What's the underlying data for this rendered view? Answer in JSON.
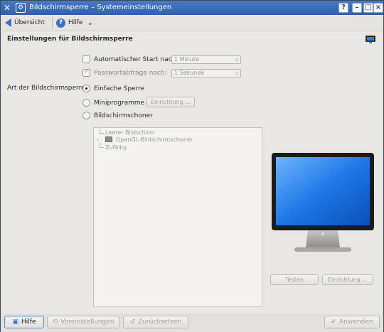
{
  "window": {
    "title": "Bildschirmsperre – Systemeinstellungen",
    "buttons": [
      "?",
      "–",
      "□",
      "×"
    ]
  },
  "toolbar": {
    "overview_label": "Übersicht",
    "help_label": "Hilfe",
    "help_menu_glyph": "⌄"
  },
  "page": {
    "heading": "Einstellungen für Bildschirmsperre"
  },
  "options": {
    "autostart_label": "Automatischer Start nach:",
    "autostart_value": "1 Minute",
    "autostart_checked": false,
    "password_label": "Passwortabfrage nach:",
    "password_value": "1 Sekunde",
    "password_checked": true,
    "lock_type_label": "Art der Bildschirmsperre:",
    "radio_simple": "Einfache Sperre",
    "radio_widgets": "Miniprogramme",
    "radio_screensaver": "Bildschirmschoner",
    "setup_button": "Einrichtung ..."
  },
  "screensaver_list": [
    "Leerer Bildschirm",
    "OpenGL-Bildschirmschoner",
    "Zufällig"
  ],
  "preview": {
    "test_button": "Testen",
    "setup_button": "Einrichtung ..."
  },
  "footer": {
    "help": "Hilfe",
    "defaults": "Voreinstellungen",
    "reset": "Zurücksetzen",
    "apply": "Anwenden"
  },
  "colors": {
    "titlebar": "#3a6ab8",
    "accent": "#3f72c4",
    "screen": "#1f78e0"
  }
}
